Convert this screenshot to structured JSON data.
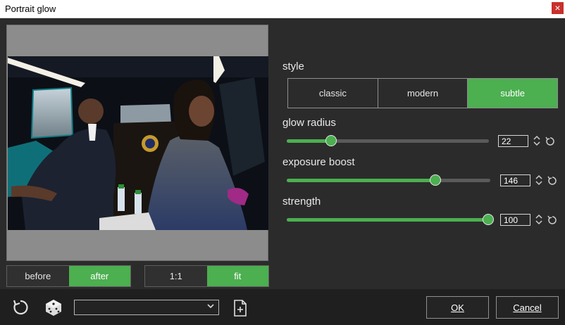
{
  "window": {
    "title": "Portrait glow",
    "close_glyph": "×"
  },
  "preview": {
    "toggle": [
      "before",
      "after"
    ],
    "zoom": [
      "1:1",
      "fit"
    ],
    "active_toggle": "after",
    "active_zoom": "fit"
  },
  "style": {
    "label": "style",
    "options": [
      "classic",
      "modern",
      "subtle"
    ],
    "selected": "subtle"
  },
  "sliders": [
    {
      "label": "glow radius",
      "value": "22",
      "min": 0,
      "max": 100,
      "fraction": 0.22
    },
    {
      "label": "exposure boost",
      "value": "146",
      "min": 0,
      "max": 200,
      "fraction": 0.73
    },
    {
      "label": "strength",
      "value": "100",
      "min": 0,
      "max": 100,
      "fraction": 1.0
    }
  ],
  "icons": {
    "reset": "reset-icon",
    "random": "dice-icon",
    "new_preset": "new-preset-icon"
  },
  "buttons": {
    "ok": "OK",
    "cancel": "Cancel"
  },
  "colors": {
    "accent": "#4caf50",
    "bg": "#2b2b2b"
  }
}
